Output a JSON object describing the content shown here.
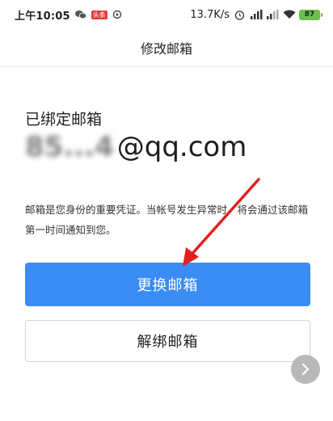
{
  "status_bar": {
    "time": "上午10:05",
    "news_badge": "头条",
    "net_speed": "13.7K/s",
    "battery": "87"
  },
  "header": {
    "title": "修改邮箱"
  },
  "email": {
    "label": "已绑定邮箱",
    "masked_prefix": "85...4",
    "domain": "@qq.com"
  },
  "description": "邮箱是您身份的重要凭证。当帐号发生异常时，将会通过该邮箱第一时间通知到您。",
  "buttons": {
    "change": "更换邮箱",
    "unbind": "解绑邮箱"
  },
  "colors": {
    "primary": "#3b8cf4",
    "annotation_arrow": "#e02020"
  },
  "icons": [
    "wechat-icon",
    "news-icon",
    "signal-icon",
    "alarm-icon",
    "wifi-icon",
    "battery-icon",
    "chevron-right-icon"
  ]
}
